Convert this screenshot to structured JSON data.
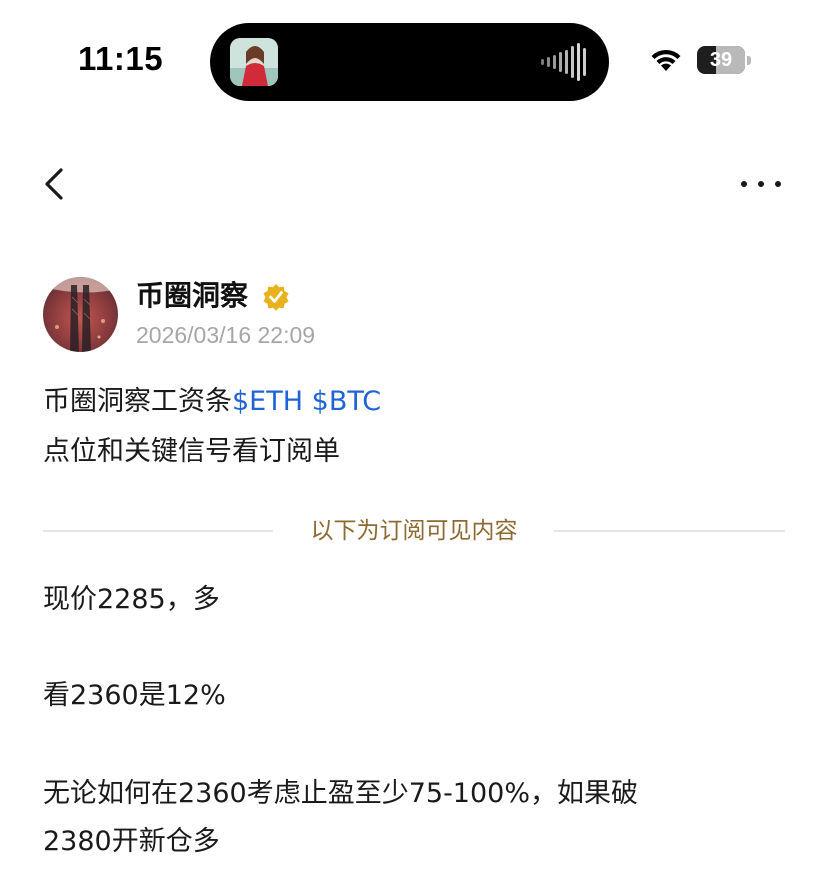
{
  "status_bar": {
    "time": "11:15",
    "battery_level": "39",
    "battery_fraction": 0.39,
    "wifi_icon": "wifi-icon",
    "island_media_icon": "audio-waveform-icon"
  },
  "nav": {
    "back_icon": "chevron-left-icon",
    "more_icon": "ellipsis-icon"
  },
  "post": {
    "author": "币圈洞察",
    "verified_icon": "verified-badge-icon",
    "timestamp": "2026/03/16 22:09",
    "title_text": "币圈洞察工资条",
    "tickers": [
      "$ETH",
      "$BTC"
    ],
    "subtitle": "点位和关键信号看订阅单",
    "divider_label": "以下为订阅可见内容",
    "paragraphs": [
      "现价2285，多",
      "看2360是12%",
      "无论如何在2360考虑止盈至少75-100%，如果破",
      "2380开新仓多"
    ]
  },
  "colors": {
    "ticker": "#1f63d6",
    "divider_label": "#8c6a32",
    "timestamp": "#a6a6a6",
    "badge": "#e8b21c"
  }
}
